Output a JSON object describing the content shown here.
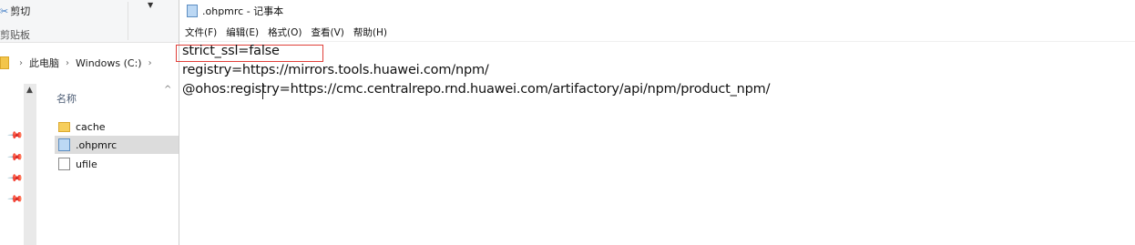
{
  "explorer": {
    "ribbon": {
      "cut_label": "剪切",
      "clipboard_label": "剪贴板"
    },
    "address": {
      "crumbs": [
        "此电脑",
        "Windows (C:)"
      ]
    },
    "column_header": "名称",
    "files": [
      {
        "name": "cache",
        "type": "folder"
      },
      {
        "name": ".ohpmrc",
        "type": "notepad-file"
      },
      {
        "name": "ufile",
        "type": "file"
      }
    ]
  },
  "notepad": {
    "title": ".ohpmrc - 记事本",
    "menu": [
      "文件(F)",
      "编辑(E)",
      "格式(O)",
      "查看(V)",
      "帮助(H)"
    ],
    "lines": [
      "strict_ssl=false",
      "registry=https://mirrors.tools.huawei.com/npm/",
      "@ohos:registry=https://cmc.centralrepo.rnd.huawei.com/artifactory/api/npm/product_npm/"
    ],
    "highlight_color": "#e0403a"
  }
}
